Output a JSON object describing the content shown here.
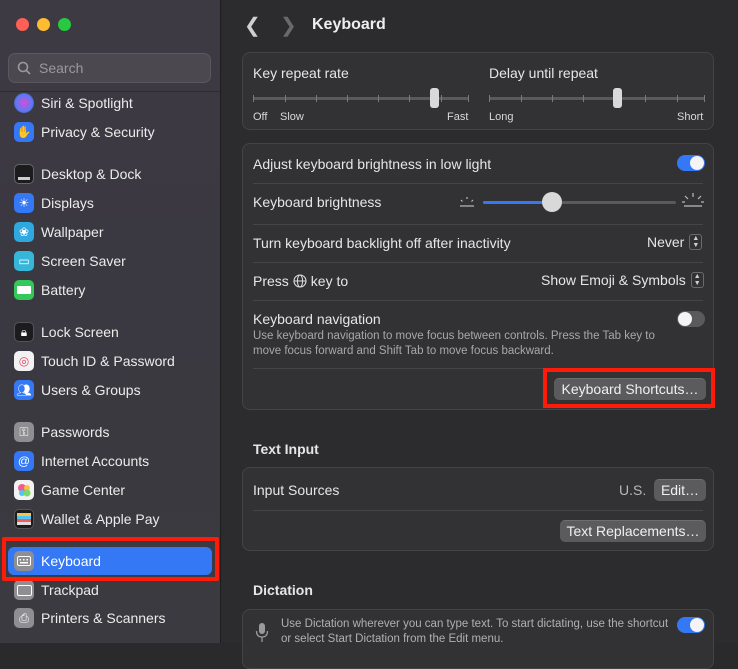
{
  "sidebar": {
    "search_placeholder": "Search",
    "items": [
      {
        "label": "Siri & Spotlight",
        "icon": "siri-icon",
        "color": "#2b2b2b"
      },
      {
        "label": "Privacy & Security",
        "icon": "hand-icon",
        "color": "#3478f6"
      },
      {
        "label": "Desktop & Dock",
        "icon": "dock-icon",
        "color": "#1c1c1e"
      },
      {
        "label": "Displays",
        "icon": "sun-icon",
        "color": "#3478f6"
      },
      {
        "label": "Wallpaper",
        "icon": "flower-icon",
        "color": "#2fa8e0"
      },
      {
        "label": "Screen Saver",
        "icon": "screensaver-icon",
        "color": "#36b6d8"
      },
      {
        "label": "Battery",
        "icon": "battery-icon",
        "color": "#34c759"
      },
      {
        "label": "Lock Screen",
        "icon": "lock-icon",
        "color": "#1c1c1e"
      },
      {
        "label": "Touch ID & Password",
        "icon": "fingerprint-icon",
        "color": "#f2f2f2"
      },
      {
        "label": "Users & Groups",
        "icon": "users-icon",
        "color": "#3478f6"
      },
      {
        "label": "Passwords",
        "icon": "key-icon",
        "color": "#8e8e93"
      },
      {
        "label": "Internet Accounts",
        "icon": "at-icon",
        "color": "#3478f6"
      },
      {
        "label": "Game Center",
        "icon": "game-center-icon",
        "color": "#f2f2f2"
      },
      {
        "label": "Wallet & Apple Pay",
        "icon": "wallet-icon",
        "color": "#1c1c1e"
      },
      {
        "label": "Keyboard",
        "icon": "keyboard-icon",
        "color": "#8e8e93",
        "selected": true
      },
      {
        "label": "Trackpad",
        "icon": "trackpad-icon",
        "color": "#8e8e93"
      },
      {
        "label": "Printers & Scanners",
        "icon": "printer-icon",
        "color": "#8e8e93"
      }
    ]
  },
  "header": {
    "title": "Keyboard"
  },
  "repeat": {
    "key_repeat_label": "Key repeat rate",
    "key_repeat_min_1": "Off",
    "key_repeat_min_2": "Slow",
    "key_repeat_max": "Fast",
    "key_repeat_level": 0.88,
    "delay_label": "Delay until repeat",
    "delay_min": "Long",
    "delay_max": "Short",
    "delay_level": 0.6
  },
  "settings": {
    "adjust_brightness_label": "Adjust keyboard brightness in low light",
    "adjust_brightness_on": true,
    "brightness_label": "Keyboard brightness",
    "brightness_level": 0.32,
    "backlight_off_label": "Turn keyboard backlight off after inactivity",
    "backlight_off_value": "Never",
    "press_key_label_pre": "Press",
    "press_key_label_post": "key to",
    "press_key_value": "Show Emoji & Symbols",
    "nav_label": "Keyboard navigation",
    "nav_desc": "Use keyboard navigation to move focus between controls. Press the Tab key to move focus forward and Shift Tab to move focus backward.",
    "nav_on": false,
    "shortcuts_button": "Keyboard Shortcuts…"
  },
  "text_input": {
    "section_title": "Text Input",
    "input_sources_label": "Input Sources",
    "input_sources_value": "U.S.",
    "edit_button": "Edit…",
    "replacements_button": "Text Replacements…"
  },
  "dictation": {
    "section_title": "Dictation",
    "desc": "Use Dictation wherever you can type text. To start dictating, use the shortcut or select Start Dictation from the Edit menu.",
    "on": true
  },
  "colors": {
    "accent": "#3478f6",
    "highlight": "#ff1b0a"
  }
}
